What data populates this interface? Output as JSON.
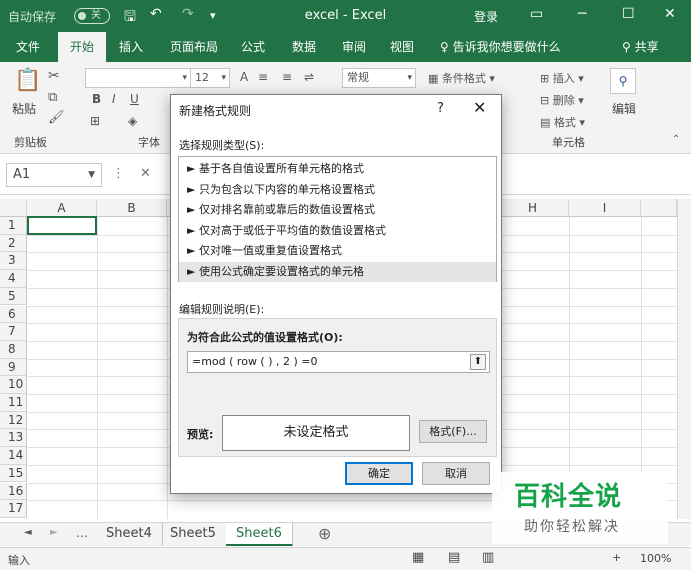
{
  "titlebar": {
    "autosave_label": "自动保存",
    "autosave_state": "关",
    "window_title": "excel  -  Excel",
    "login_label": "登录"
  },
  "ribbon_tabs": [
    "文件",
    "开始",
    "插入",
    "页面布局",
    "公式",
    "数据",
    "审阅",
    "视图"
  ],
  "active_tab": "开始",
  "tell_me": "告诉我你想要做什么",
  "share_label": "共享",
  "ribbon": {
    "paste_label": "粘贴",
    "clipboard_group": "剪贴板",
    "font_group": "字体",
    "font_size": "12",
    "number_format": "常规",
    "conditional_format": "条件格式",
    "insert_label": "插入",
    "delete_label": "删除",
    "format_label": "格式",
    "cells_group": "单元格",
    "edit_label": "编辑"
  },
  "formula_bar": {
    "name_box": "A1"
  },
  "grid": {
    "columns": [
      "A",
      "B",
      "H",
      "I"
    ],
    "rows": [
      "1",
      "2",
      "3",
      "4",
      "5",
      "6",
      "7",
      "8",
      "9",
      "10",
      "11",
      "12",
      "13",
      "14",
      "15",
      "16",
      "17"
    ]
  },
  "sheets": [
    "Sheet4",
    "Sheet5",
    "Sheet6"
  ],
  "active_sheet": "Sheet6",
  "statusbar": {
    "mode": "输入",
    "zoom": "100%"
  },
  "dialog": {
    "title": "新建格式规则",
    "help": "?",
    "select_rule_type_label": "选择规则类型(S):",
    "rule_types": [
      "► 基于各自值设置所有单元格的格式",
      "► 只为包含以下内容的单元格设置格式",
      "► 仅对排名靠前或靠后的数值设置格式",
      "► 仅对高于或低于平均值的数值设置格式",
      "► 仅对唯一值或重复值设置格式",
      "► 使用公式确定要设置格式的单元格"
    ],
    "selected_rule_index": 5,
    "edit_rule_label": "编辑规则说明(E):",
    "formula_label": "为符合此公式的值设置格式(O):",
    "formula_value": "=mod ( row ( ) , 2 ) =0",
    "preview_label": "预览:",
    "preview_text": "未设定格式",
    "format_button": "格式(F)...",
    "ok_button": "确定",
    "cancel_button": "取消"
  },
  "watermark": {
    "title": "百科全说",
    "subtitle": "助你轻松解决"
  },
  "colors": {
    "excel_green": "#217346",
    "watermark_green": "#16a34a"
  }
}
